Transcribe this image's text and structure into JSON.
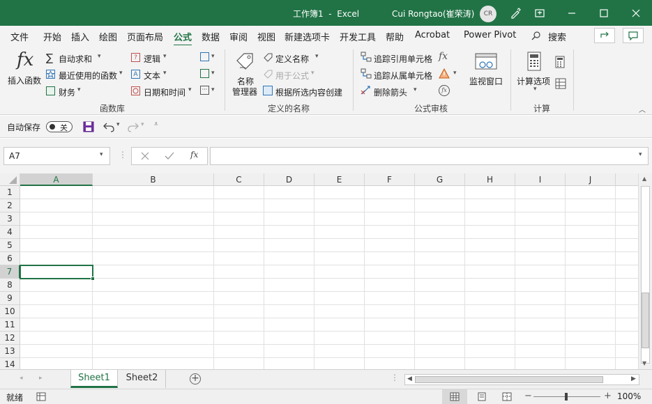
{
  "title": {
    "doc": "工作簿1",
    "sep": "-",
    "app": "Excel",
    "user": "Cui Rongtao(崔荣涛)",
    "avatar": "CR"
  },
  "tabs": [
    "文件",
    "开始",
    "插入",
    "绘图",
    "页面布局",
    "公式",
    "数据",
    "审阅",
    "视图",
    "新建选项卡",
    "开发工具",
    "帮助",
    "Acrobat",
    "Power Pivot"
  ],
  "active_tab": "公式",
  "search": "搜索",
  "ribbon": {
    "insert_function": "插入函数",
    "autosum": "自动求和",
    "recent": "最近使用的函数",
    "financial": "财务",
    "logical": "逻辑",
    "text": "文本",
    "datetime": "日期和时间",
    "group1": "函数库",
    "name_manager_1": "名称",
    "name_manager_2": "管理器",
    "define_name": "定义名称",
    "use_in_formula": "用于公式",
    "create_from_sel": "根据所选内容创建",
    "group2": "定义的名称",
    "trace_precedents": "追踪引用单元格",
    "trace_dependents": "追踪从属单元格",
    "remove_arrows": "删除箭头",
    "watch_window": "监视窗口",
    "group3": "公式审核",
    "calc_options": "计算选项",
    "group4": "计算"
  },
  "qat": {
    "autosave": "自动保存",
    "toggle": "关"
  },
  "namebox": "A7",
  "columns": [
    "A",
    "B",
    "C",
    "D",
    "E",
    "F",
    "G",
    "H",
    "I",
    "J"
  ],
  "rows": [
    "1",
    "2",
    "3",
    "4",
    "5",
    "6",
    "7",
    "8",
    "9",
    "10",
    "11",
    "12",
    "13",
    "14"
  ],
  "selected_cell": "A7",
  "sheets": [
    "Sheet1",
    "Sheet2"
  ],
  "active_sheet": "Sheet1",
  "status": {
    "mode": "就绪",
    "zoom": "100%"
  },
  "colors": {
    "accent": "#217346"
  }
}
